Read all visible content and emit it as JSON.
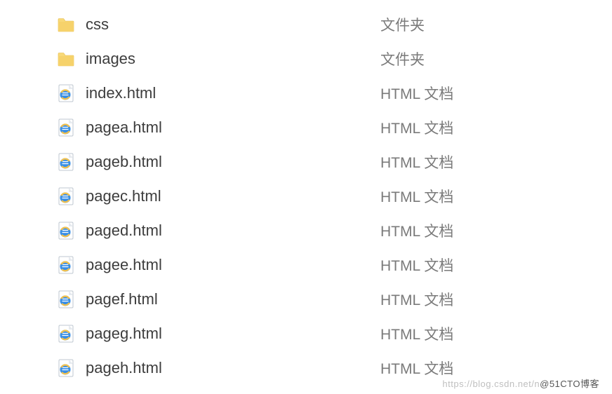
{
  "files": [
    {
      "name": "css",
      "type": "文件夹",
      "icon": "folder"
    },
    {
      "name": "images",
      "type": "文件夹",
      "icon": "folder"
    },
    {
      "name": "index.html",
      "type": "HTML 文档",
      "icon": "html"
    },
    {
      "name": "pagea.html",
      "type": "HTML 文档",
      "icon": "html"
    },
    {
      "name": "pageb.html",
      "type": "HTML 文档",
      "icon": "html"
    },
    {
      "name": "pagec.html",
      "type": "HTML 文档",
      "icon": "html"
    },
    {
      "name": "paged.html",
      "type": "HTML 文档",
      "icon": "html"
    },
    {
      "name": "pagee.html",
      "type": "HTML 文档",
      "icon": "html"
    },
    {
      "name": "pagef.html",
      "type": "HTML 文档",
      "icon": "html"
    },
    {
      "name": "pageg.html",
      "type": "HTML 文档",
      "icon": "html"
    },
    {
      "name": "pageh.html",
      "type": "HTML 文档",
      "icon": "html"
    }
  ],
  "watermark": {
    "faint": "https://blog.csdn.net/n",
    "dark": "@51CTO博客"
  }
}
